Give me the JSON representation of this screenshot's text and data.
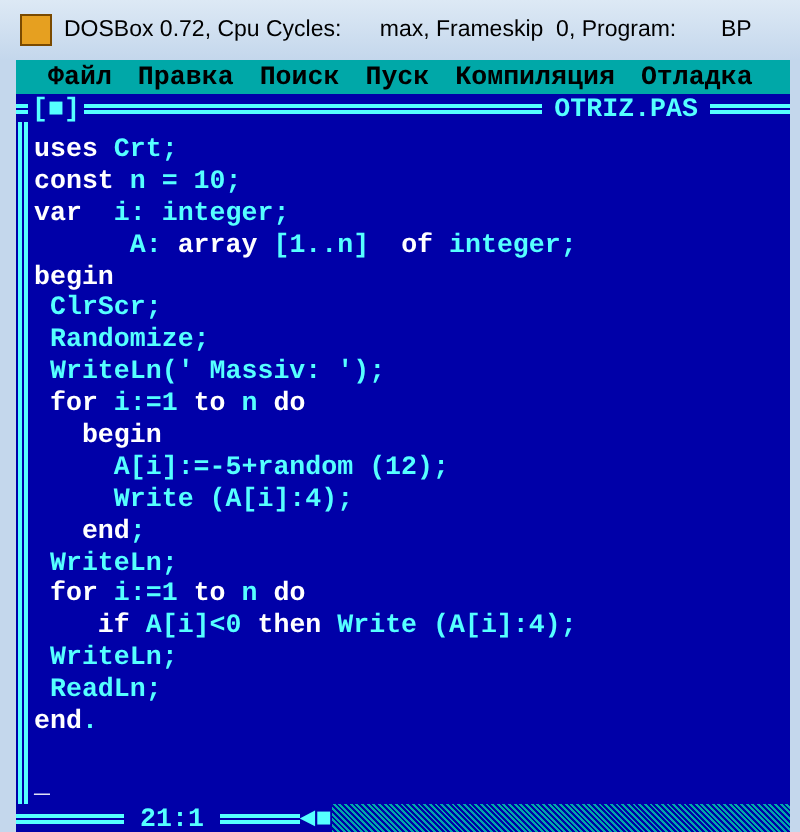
{
  "window": {
    "title": "DOSBox 0.72, Cpu Cycles:      max, Frameskip  0, Program:       BP"
  },
  "menu": [
    "Файл",
    "Правка",
    "Поиск",
    "Пуск",
    "Компиляция",
    "Отладка"
  ],
  "editor": {
    "close_box": "[■]",
    "filename": "OTRIZ.PAS",
    "lines": [
      [
        {
          "text": "uses",
          "kind": "keyword"
        },
        {
          "text": " Crt;",
          "kind": "text"
        }
      ],
      [
        {
          "text": "const",
          "kind": "keyword"
        },
        {
          "text": " n = 10;",
          "kind": "text"
        }
      ],
      [
        {
          "text": "var",
          "kind": "keyword"
        },
        {
          "text": "  i: integer;",
          "kind": "text"
        }
      ],
      [
        {
          "text": "      A: ",
          "kind": "text"
        },
        {
          "text": "array",
          "kind": "keyword"
        },
        {
          "text": " [1..n]  ",
          "kind": "text"
        },
        {
          "text": "of",
          "kind": "keyword"
        },
        {
          "text": " integer;",
          "kind": "text"
        }
      ],
      [
        {
          "text": "begin",
          "kind": "keyword"
        }
      ],
      [
        {
          "text": " ClrScr;",
          "kind": "text"
        }
      ],
      [
        {
          "text": " Randomize;",
          "kind": "text"
        }
      ],
      [
        {
          "text": " WriteLn(' Massiv: ');",
          "kind": "text"
        }
      ],
      [
        {
          "text": " for",
          "kind": "keyword"
        },
        {
          "text": " i:=1 ",
          "kind": "text"
        },
        {
          "text": "to",
          "kind": "keyword"
        },
        {
          "text": " n ",
          "kind": "text"
        },
        {
          "text": "do",
          "kind": "keyword"
        }
      ],
      [
        {
          "text": "   begin",
          "kind": "keyword"
        }
      ],
      [
        {
          "text": "     A[i]:=-5+random (12);",
          "kind": "text"
        }
      ],
      [
        {
          "text": "     Write (A[i]:4);",
          "kind": "text"
        }
      ],
      [
        {
          "text": "   end",
          "kind": "keyword"
        },
        {
          "text": ";",
          "kind": "text"
        }
      ],
      [
        {
          "text": " WriteLn;",
          "kind": "text"
        }
      ],
      [
        {
          "text": " for",
          "kind": "keyword"
        },
        {
          "text": " i:=1 ",
          "kind": "text"
        },
        {
          "text": "to",
          "kind": "keyword"
        },
        {
          "text": " n ",
          "kind": "text"
        },
        {
          "text": "do",
          "kind": "keyword"
        }
      ],
      [
        {
          "text": "    if",
          "kind": "keyword"
        },
        {
          "text": " A[i]<0 ",
          "kind": "text"
        },
        {
          "text": "then",
          "kind": "keyword"
        },
        {
          "text": " Write (A[i]:4);",
          "kind": "text"
        }
      ],
      [
        {
          "text": " WriteLn;",
          "kind": "text"
        }
      ],
      [
        {
          "text": " ReadLn;",
          "kind": "text"
        }
      ],
      [
        {
          "text": "end",
          "kind": "keyword"
        },
        {
          "text": ".",
          "kind": "text"
        }
      ]
    ],
    "cursor": "_",
    "position": "21:1",
    "scroll_left": "◄",
    "scroll_thumb": "■"
  }
}
